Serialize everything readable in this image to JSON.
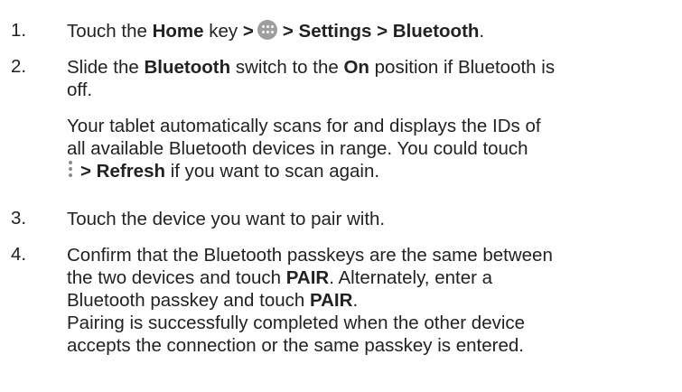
{
  "steps": [
    {
      "number": "1.",
      "line1": {
        "t1": "Touch the ",
        "home": "Home",
        "t2": " key ",
        "gt1": ">",
        "apps_icon": "apps-grid-icon",
        "gt2": ">",
        "settings": " Settings",
        "gt3": " >",
        "bluetooth": " Bluetooth",
        "end": "."
      }
    },
    {
      "number": "2.",
      "line1": {
        "t1": "Slide the ",
        "bluetooth": "Bluetooth",
        "t2": " switch to the ",
        "on": "On",
        "t3": " position if Bluetooth is"
      },
      "line2": "off.",
      "sub": {
        "line1": "Your tablet automatically scans for and displays the IDs of",
        "line2": "all available Bluetooth devices in range. You could touch",
        "more_icon": "more-options-icon",
        "refresh": "> Refresh",
        "after": " if you want to scan again."
      }
    },
    {
      "number": "3.",
      "line1": "Touch the device you want to pair with."
    },
    {
      "number": "4.",
      "line1": "Confirm that the Bluetooth passkeys are the same between",
      "line2": {
        "t1": "the two devices and touch ",
        "pair": "PAIR",
        "t2": ". Alternately, enter a"
      },
      "line3": {
        "t1": "Bluetooth passkey and touch ",
        "pair": "PAIR",
        "t2": "."
      },
      "line4": "Pairing is successfully completed when the other device",
      "line5": "accepts the connection or the same passkey is entered."
    }
  ]
}
